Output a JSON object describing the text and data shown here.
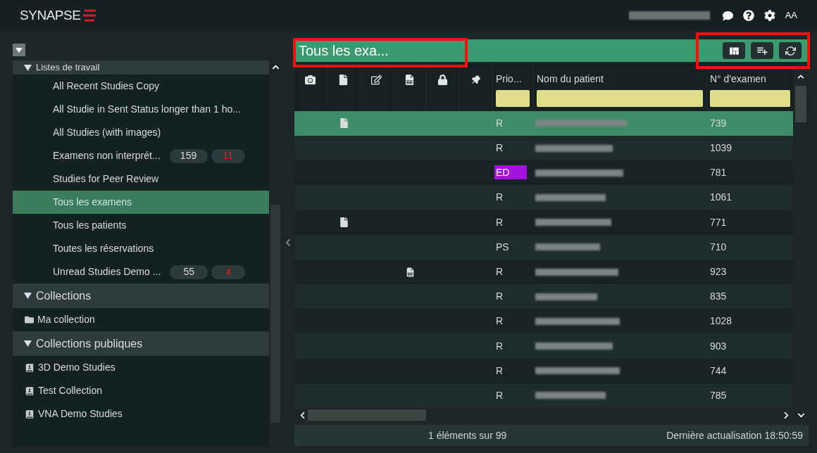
{
  "app": {
    "logo": "SYNAPSE",
    "font_button": "AA"
  },
  "sidebar": {
    "sections": [
      {
        "title": "Listes de travail",
        "expanded": true,
        "kind": "worklist",
        "items": [
          {
            "label": "All Recent Studies Copy",
            "selected": false
          },
          {
            "label": "All Studie  in Sent Status longer than 1 ho...",
            "selected": false
          },
          {
            "label": "All Studies (with images)",
            "selected": false
          },
          {
            "label": "Examens non interprét...",
            "selected": false,
            "count": "159",
            "urgent": "11"
          },
          {
            "label": "Studies for Peer Review",
            "selected": false
          },
          {
            "label": "Tous les examens",
            "selected": true
          },
          {
            "label": "Tous les patients",
            "selected": false
          },
          {
            "label": "Toutes les réservations",
            "selected": false
          },
          {
            "label": "Unread Studies Demo ...",
            "selected": false,
            "count": "55",
            "urgent": "4"
          }
        ]
      },
      {
        "title": "Collections",
        "expanded": true,
        "kind": "private",
        "items": [
          {
            "label": "Ma collection",
            "selected": false
          }
        ]
      },
      {
        "title": "Collections publiques",
        "expanded": true,
        "kind": "public",
        "items": [
          {
            "label": "3D Demo Studies",
            "selected": false
          },
          {
            "label": "Test Collection",
            "selected": false
          },
          {
            "label": "VNA Demo Studies",
            "selected": false
          }
        ]
      }
    ]
  },
  "list": {
    "title": "Tous les exa...",
    "columns": [
      "Prio...",
      "Nom du patient",
      "N° d'examen"
    ],
    "rows": [
      {
        "selected": true,
        "kind": "document",
        "priority": "R",
        "exam": "739"
      },
      {
        "selected": false,
        "priority": "R",
        "exam": "1039"
      },
      {
        "selected": false,
        "priority": "ED",
        "color": "#a312dc",
        "exam": "781"
      },
      {
        "selected": false,
        "priority": "R",
        "exam": "1061"
      },
      {
        "selected": false,
        "kind": "document",
        "priority": "R",
        "exam": "771"
      },
      {
        "selected": false,
        "priority": "PS",
        "exam": "710"
      },
      {
        "selected": false,
        "kind": "form",
        "priority": "R",
        "exam": "923"
      },
      {
        "selected": false,
        "priority": "R",
        "exam": "835"
      },
      {
        "selected": false,
        "priority": "R",
        "exam": "1028"
      },
      {
        "selected": false,
        "priority": "R",
        "exam": "903"
      },
      {
        "selected": false,
        "priority": "R",
        "exam": "744"
      },
      {
        "selected": false,
        "priority": "R",
        "exam": "785"
      }
    ],
    "status_left": "1 éléments sur 99",
    "status_right": "Dernière actualisation 18:50:59"
  }
}
